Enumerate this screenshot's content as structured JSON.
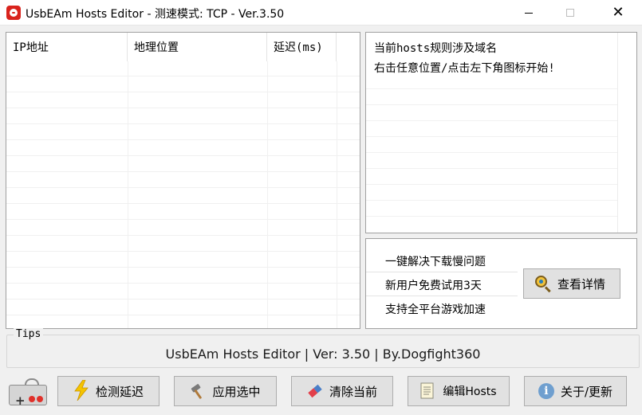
{
  "window": {
    "title": "UsbEAm Hosts Editor - 测速模式: TCP - Ver.3.50",
    "minimize_glyph": "",
    "maximize_glyph": "",
    "close_glyph": "✕"
  },
  "ip_list": {
    "columns": [
      "IP地址",
      "地理位置",
      "延迟(ms)"
    ],
    "rows": []
  },
  "rules_panel": {
    "lines": [
      "当前hosts规则涉及域名",
      "右击任意位置/点击左下角图标开始!"
    ]
  },
  "promo": {
    "items": [
      "一键解决下载慢问题",
      "新用户免费试用3天",
      "支持全平台游戏加速"
    ],
    "detail_button": "查看详情",
    "detail_icon": "magnifier-icon"
  },
  "tips": {
    "label": "Tips",
    "text": "UsbEAm Hosts Editor | Ver: 3.50 | By.Dogfight360"
  },
  "toolbar": {
    "gamepad_icon": "gamepad-icon",
    "buttons": [
      {
        "label": "检测延迟",
        "icon": "lightning-icon"
      },
      {
        "label": "应用选中",
        "icon": "hammer-icon"
      },
      {
        "label": "清除当前",
        "icon": "eraser-icon"
      },
      {
        "label": "编辑Hosts",
        "icon": "document-icon"
      },
      {
        "label": "关于/更新",
        "icon": "info-icon"
      }
    ]
  },
  "colors": {
    "window_bg": "#f0f0f0",
    "panel_bg": "#ffffff",
    "border": "#a0a0a0",
    "button_bg": "#e1e1e1",
    "app_icon_red": "#d9231d"
  }
}
